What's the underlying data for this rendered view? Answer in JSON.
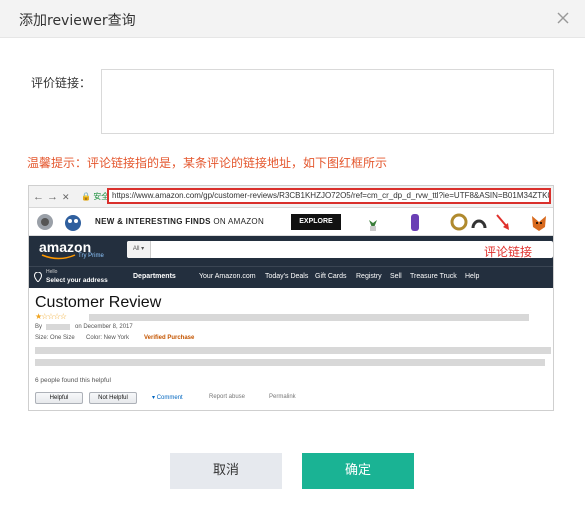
{
  "dialog": {
    "title": "添加reviewer查询",
    "close_icon": "close-icon"
  },
  "form": {
    "link_label": "评价链接：",
    "link_value": "",
    "link_placeholder": ""
  },
  "hint": "温馨提示：评论链接指的是，某条评论的链接地址，如下图红框所示",
  "example": {
    "browser": {
      "back": "←",
      "forward": "→",
      "stop": "✕",
      "secure": "安全",
      "url": "https://www.amazon.com/gp/customer-reviews/R3CB1KHZJO72O5/ref=cm_cr_dp_d_rvw_ttl?ie=UTF8&ASIN=B01M34ZTK0"
    },
    "promo": {
      "text_bold": "NEW & INTERESTING FINDS",
      "text_normal": " ON AMAZON",
      "explore": "EXPLORE"
    },
    "amazon": {
      "logo": "amazon",
      "prime": "Try Prime",
      "search_category": "All ▾",
      "annotation": "评论链接"
    },
    "nav": {
      "hello": "Hello",
      "address": "Select your address",
      "departments": "Departments",
      "links": [
        "Your Amazon.com",
        "Today's Deals",
        "Gift Cards",
        "Registry",
        "Sell",
        "Treasure Truck",
        "Help"
      ]
    },
    "review": {
      "title": "Customer Review",
      "stars": "★☆☆☆☆",
      "by": "By",
      "date": "on December 8, 2017",
      "size": "Size: One Size",
      "color": "Color: New York",
      "verified": "Verified Purchase",
      "helpful_count": "6 people found this helpful",
      "helpful_btn": "Helpful",
      "not_helpful_btn": "Not Helpful",
      "comment": "Comment",
      "report": "Report abuse",
      "permalink": "Permalink"
    }
  },
  "buttons": {
    "cancel": "取消",
    "confirm": "确定"
  },
  "colors": {
    "hint": "#e4572e",
    "confirm": "#1ab394",
    "cancel": "#e6e9ee",
    "highlight": "#d9302c"
  }
}
